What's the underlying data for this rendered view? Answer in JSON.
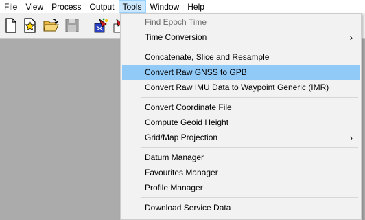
{
  "menubar": {
    "items": [
      {
        "label": "File"
      },
      {
        "label": "View"
      },
      {
        "label": "Process"
      },
      {
        "label": "Output"
      },
      {
        "label": "Tools"
      },
      {
        "label": "Window"
      },
      {
        "label": "Help"
      }
    ],
    "active": "Tools"
  },
  "toolbar": {
    "buttons": [
      "new-document-icon",
      "new-project-star-icon",
      "open-folder-icon",
      "save-disk-icon",
      "process-wizard-icon",
      "process-icon"
    ]
  },
  "tools_menu": {
    "items": [
      {
        "label": "Find Epoch Time",
        "enabled": false
      },
      {
        "label": "Time Conversion",
        "submenu": true
      },
      {
        "label": "Concatenate, Slice and Resample"
      },
      {
        "label": "Convert Raw GNSS to GPB",
        "highlighted": true
      },
      {
        "label": "Convert Raw IMU Data to Waypoint Generic (IMR)"
      },
      {
        "label": "Convert Coordinate File"
      },
      {
        "label": "Compute Geoid Height"
      },
      {
        "label": "Grid/Map Projection",
        "submenu": true
      },
      {
        "label": "Datum Manager"
      },
      {
        "label": "Favourites Manager"
      },
      {
        "label": "Profile Manager"
      },
      {
        "label": "Download Service Data"
      }
    ],
    "submenu_arrow": "›"
  },
  "colors": {
    "menu_bg": "#f2f2f2",
    "highlight": "#91c9f7",
    "workspace": "#ababab",
    "active_menu": "#cce8ff"
  }
}
